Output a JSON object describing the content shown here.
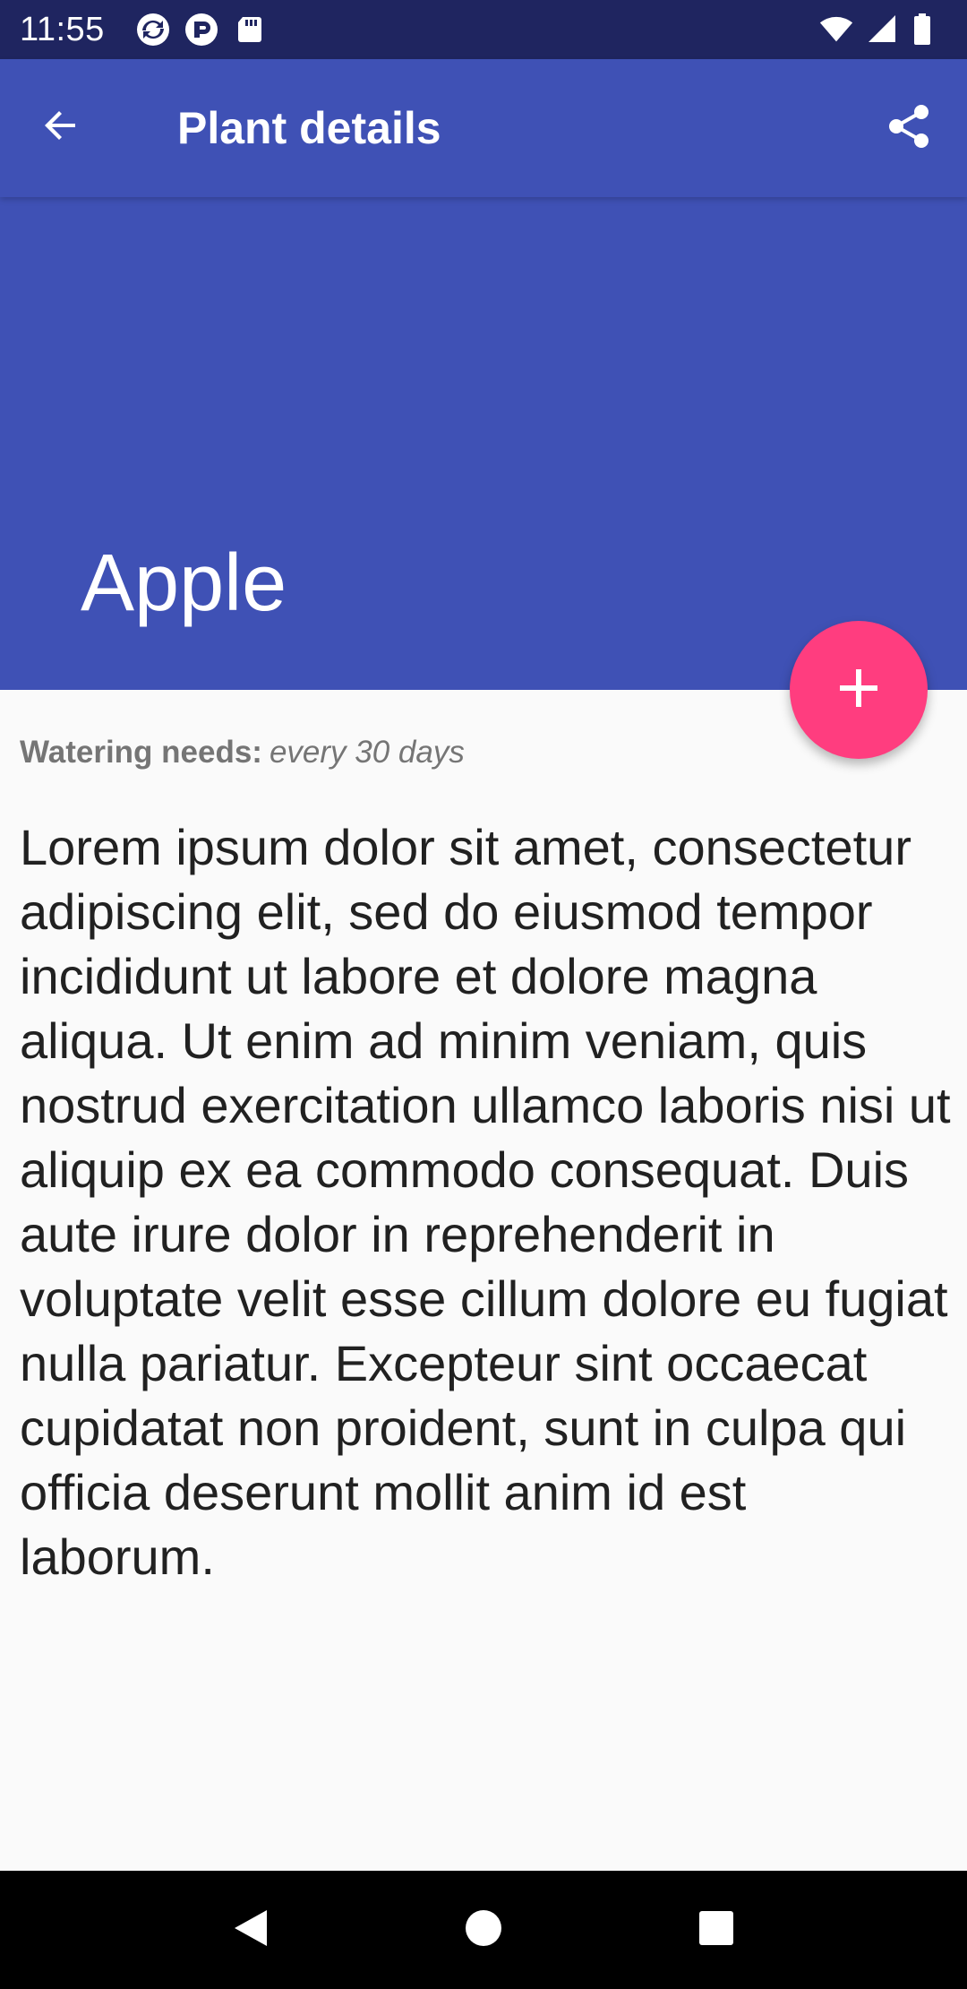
{
  "status_bar": {
    "time": "11:55",
    "left_icons": [
      "sync-icon",
      "pocket-icon",
      "sd-card-icon"
    ],
    "right_icons": [
      "wifi-icon",
      "signal-icon",
      "battery-icon"
    ]
  },
  "app_bar": {
    "title": "Plant details",
    "back_icon": "arrow-back-icon",
    "share_icon": "share-icon",
    "color": "#3f51b5"
  },
  "plant": {
    "name": "Apple",
    "watering_label": "Watering needs:",
    "watering_value": "every 30 days",
    "description": "Lorem ipsum dolor sit amet, consectetur adipiscing elit, sed do eiusmod tempor incididunt ut labore et dolore magna aliqua. Ut enim ad minim veniam, quis nostrud exercitation ullamco laboris nisi ut aliquip ex ea commodo consequat. Duis aute irure dolor in reprehenderit in voluptate velit esse cillum dolore eu fugiat nulla pariatur. Excepteur sint occaecat cupidatat non proident, sunt in culpa qui officia deserunt mollit anim id est laborum."
  },
  "fab": {
    "icon": "plus-icon",
    "color": "#ff3d7f"
  },
  "nav_bar": {
    "buttons": [
      "back-triangle-icon",
      "home-circle-icon",
      "recents-square-icon"
    ]
  }
}
